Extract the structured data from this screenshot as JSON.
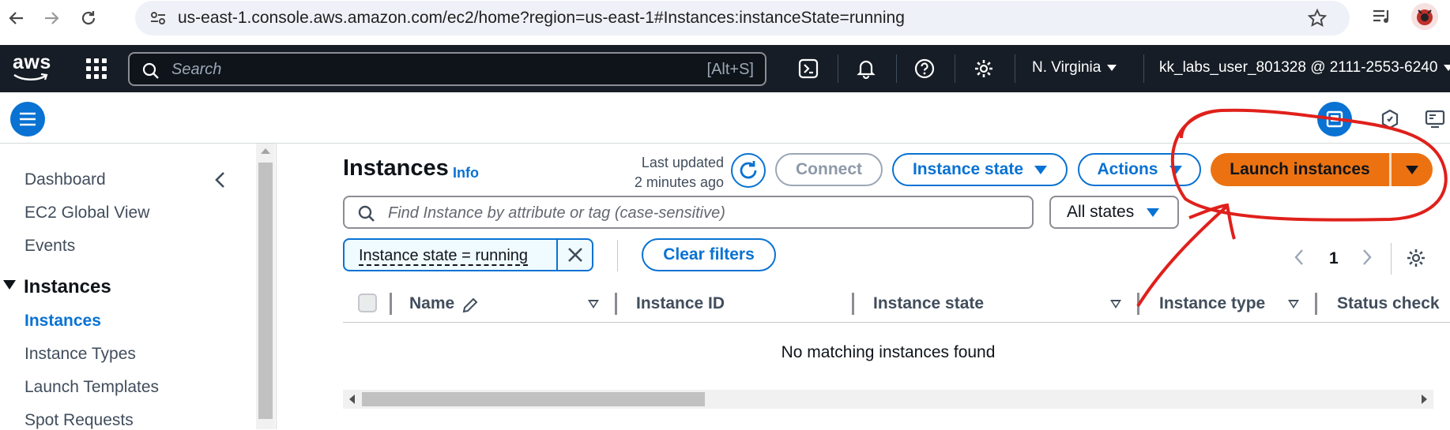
{
  "browser": {
    "url": "us-east-1.console.aws.amazon.com/ec2/home?region=us-east-1#Instances:instanceState=running",
    "back_icon": "arrow-left-icon",
    "forward_icon": "arrow-right-icon",
    "reload_icon": "reload-icon",
    "star_icon": "star-icon"
  },
  "topnav": {
    "logo": "aws",
    "search_placeholder": "Search",
    "search_shortcut": "[Alt+S]",
    "region": "N. Virginia",
    "account": "kk_labs_user_801328 @ 2111-2553-6240"
  },
  "sidebar": {
    "items": [
      {
        "label": "Dashboard"
      },
      {
        "label": "EC2 Global View"
      },
      {
        "label": "Events"
      }
    ],
    "section_heading": "Instances",
    "section_items": [
      {
        "label": "Instances",
        "active": true
      },
      {
        "label": "Instance Types"
      },
      {
        "label": "Launch Templates"
      },
      {
        "label": "Spot Requests"
      }
    ]
  },
  "main": {
    "title": "Instances",
    "info_link": "Info",
    "last_updated_line1": "Last updated",
    "last_updated_line2": "2 minutes ago",
    "connect_label": "Connect",
    "instance_state_label": "Instance state",
    "actions_label": "Actions",
    "launch_label": "Launch instances",
    "find_placeholder": "Find Instance by attribute or tag (case-sensitive)",
    "state_filter": "All states",
    "filter_token": "Instance state = running",
    "clear_filters": "Clear filters",
    "page_number": "1",
    "columns": [
      "Name",
      "Instance ID",
      "Instance state",
      "Instance type",
      "Status check"
    ],
    "empty_message": "No matching instances found"
  },
  "colors": {
    "accent": "#0972d3",
    "launch_button": "#ec7211",
    "topnav_bg": "#161d26",
    "annotation": "#e0201b"
  }
}
